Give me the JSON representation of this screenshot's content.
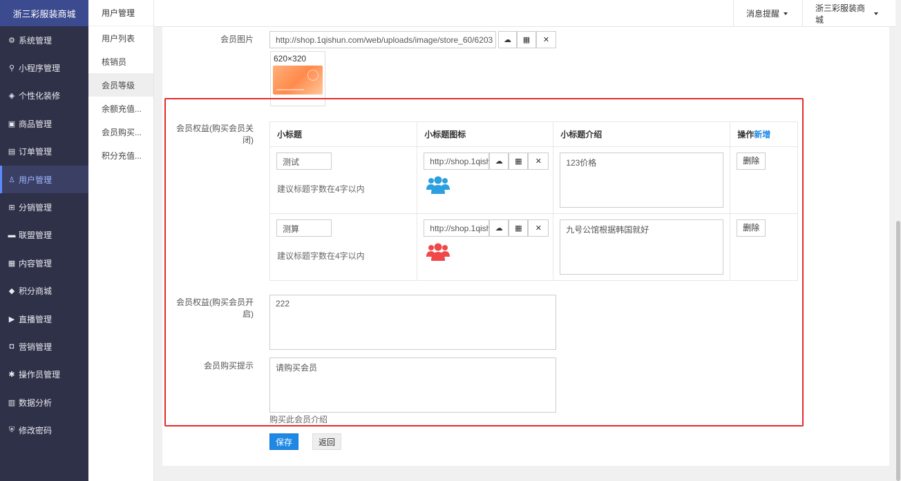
{
  "brand": "浙三彩服装商城",
  "sidebar": {
    "items": [
      {
        "label": "系统管理",
        "icon": "gear-icon",
        "glyph": "⚙"
      },
      {
        "label": "小程序管理",
        "icon": "link-icon",
        "glyph": "⚲"
      },
      {
        "label": "个性化装修",
        "icon": "diamond-icon",
        "glyph": "◈"
      },
      {
        "label": "商品管理",
        "icon": "bag-icon",
        "glyph": "▣"
      },
      {
        "label": "订单管理",
        "icon": "order-icon",
        "glyph": "▤"
      },
      {
        "label": "用户管理",
        "icon": "user-icon",
        "glyph": "♙"
      },
      {
        "label": "分销管理",
        "icon": "sitemap-icon",
        "glyph": "⊞"
      },
      {
        "label": "联盟管理",
        "icon": "store-icon",
        "glyph": "▬"
      },
      {
        "label": "内容管理",
        "icon": "content-icon",
        "glyph": "▦"
      },
      {
        "label": "积分商城",
        "icon": "cube-icon",
        "glyph": "◆"
      },
      {
        "label": "直播管理",
        "icon": "play-icon",
        "glyph": "▶"
      },
      {
        "label": "营销管理",
        "icon": "marketing-icon",
        "glyph": "◘"
      },
      {
        "label": "操作员管理",
        "icon": "cog-icon",
        "glyph": "✱"
      },
      {
        "label": "数据分析",
        "icon": "chart-icon",
        "glyph": "▥"
      },
      {
        "label": "修改密码",
        "icon": "shield-icon",
        "glyph": "⛨"
      }
    ],
    "active_index": 5
  },
  "subnav": {
    "title": "用户管理",
    "items": [
      "用户列表",
      "核销员",
      "会员等级",
      "余额充值...",
      "会员购买...",
      "积分充值..."
    ],
    "active_index": 2
  },
  "topbar": {
    "messages": "消息提醒",
    "store": "浙三彩服装商城"
  },
  "form": {
    "member_image": {
      "label": "会员图片",
      "url": "http://shop.1qishun.com/web/uploads/image/store_60/6203",
      "size_hint": "620×320"
    },
    "benefits_closed": {
      "label": "会员权益(购买会员关闭)",
      "headers": {
        "title": "小标题",
        "icon": "小标题图标",
        "intro": "小标题介绍",
        "action": "操作",
        "add": "新增"
      },
      "rows": [
        {
          "title": "测试",
          "hint": "建议标题字数在4字以内",
          "icon_url": "http://shop.1qishun.com/web/uploads/image/store_60/",
          "icon_color": "#2b9fe0",
          "intro": "123价格",
          "delete": "删除"
        },
        {
          "title": "测算",
          "hint": "建议标题字数在4字以内",
          "icon_url": "http://shop.1qishun.com/web/uploads/image/store_60/",
          "icon_color": "#f04848",
          "intro": "九号公馆根据韩国就好",
          "delete": "删除"
        }
      ]
    },
    "benefits_open": {
      "label": "会员权益(购买会员开启)",
      "value": "222"
    },
    "purchase_tip": {
      "label": "会员购买提示",
      "value": "请购买会员",
      "help": "购买此会员介绍"
    },
    "save": "保存",
    "back": "返回"
  }
}
